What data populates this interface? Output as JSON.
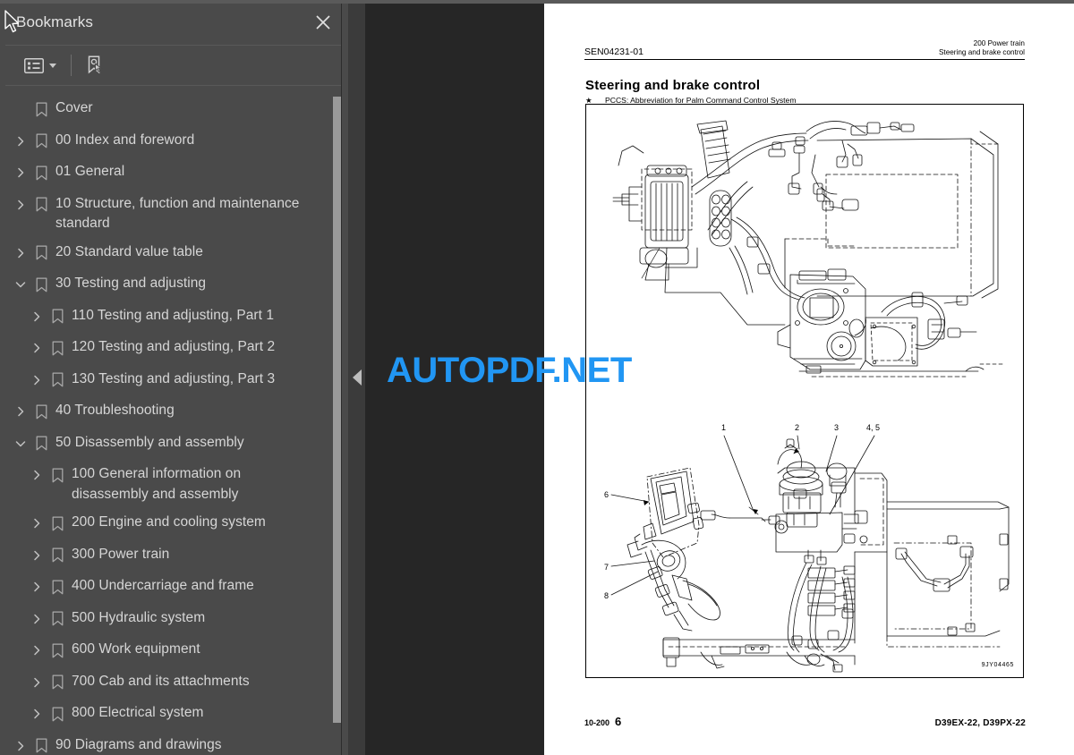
{
  "panel": {
    "title": "Bookmarks",
    "close_icon": "close-icon",
    "toolbar": {
      "list_view_icon": "list-view-icon",
      "list_view_caret_icon": "chevron-down-icon",
      "add_bookmark_icon": "add-bookmark-icon"
    }
  },
  "bookmarks": [
    {
      "label": "Cover",
      "level": 1,
      "state": "leaf"
    },
    {
      "label": "00 Index and foreword",
      "level": 1,
      "state": "collapsed"
    },
    {
      "label": "01 General",
      "level": 1,
      "state": "collapsed"
    },
    {
      "label": "10 Structure, function and maintenance standard",
      "level": 1,
      "state": "collapsed"
    },
    {
      "label": "20 Standard value table",
      "level": 1,
      "state": "collapsed"
    },
    {
      "label": "30 Testing and adjusting",
      "level": 1,
      "state": "expanded"
    },
    {
      "label": "110 Testing and adjusting, Part 1",
      "level": 2,
      "state": "collapsed"
    },
    {
      "label": "120 Testing and adjusting, Part 2",
      "level": 2,
      "state": "collapsed"
    },
    {
      "label": "130 Testing and adjusting, Part 3",
      "level": 2,
      "state": "collapsed"
    },
    {
      "label": "40 Troubleshooting",
      "level": 1,
      "state": "collapsed"
    },
    {
      "label": "50 Disassembly and assembly",
      "level": 1,
      "state": "expanded"
    },
    {
      "label": "100 General information on disassembly and assembly",
      "level": 2,
      "state": "collapsed"
    },
    {
      "label": "200 Engine and cooling system",
      "level": 2,
      "state": "collapsed"
    },
    {
      "label": "300 Power train",
      "level": 2,
      "state": "collapsed"
    },
    {
      "label": "400 Undercarriage and frame",
      "level": 2,
      "state": "collapsed"
    },
    {
      "label": "500 Hydraulic system",
      "level": 2,
      "state": "collapsed"
    },
    {
      "label": "600 Work equipment",
      "level": 2,
      "state": "collapsed"
    },
    {
      "label": "700 Cab and its attachments",
      "level": 2,
      "state": "collapsed"
    },
    {
      "label": "800 Electrical system",
      "level": 2,
      "state": "collapsed"
    },
    {
      "label": "90 Diagrams and drawings",
      "level": 1,
      "state": "collapsed"
    }
  ],
  "splitter": {
    "collapse_icon": "collapse-left-icon"
  },
  "watermark": {
    "text": "AUTOPDF.NET",
    "color": "#2196f3"
  },
  "document": {
    "header_left": "SEN04231-01",
    "header_right_line1": "200 Power train",
    "header_right_line2": "Steering and brake control",
    "title": "Steering and brake control",
    "note_marker": "★",
    "note_text": "PCCS: Abbreviation for Palm Command Control System",
    "figure_id": "9JY04465",
    "figure_callouts": [
      "1",
      "2",
      "3",
      "4, 5",
      "6",
      "7",
      "8"
    ],
    "footer_section": "10-200",
    "footer_page": "6",
    "footer_models": "D39EX-22, D39PX-22"
  },
  "cursor": {
    "icon": "mouse-pointer-icon"
  }
}
